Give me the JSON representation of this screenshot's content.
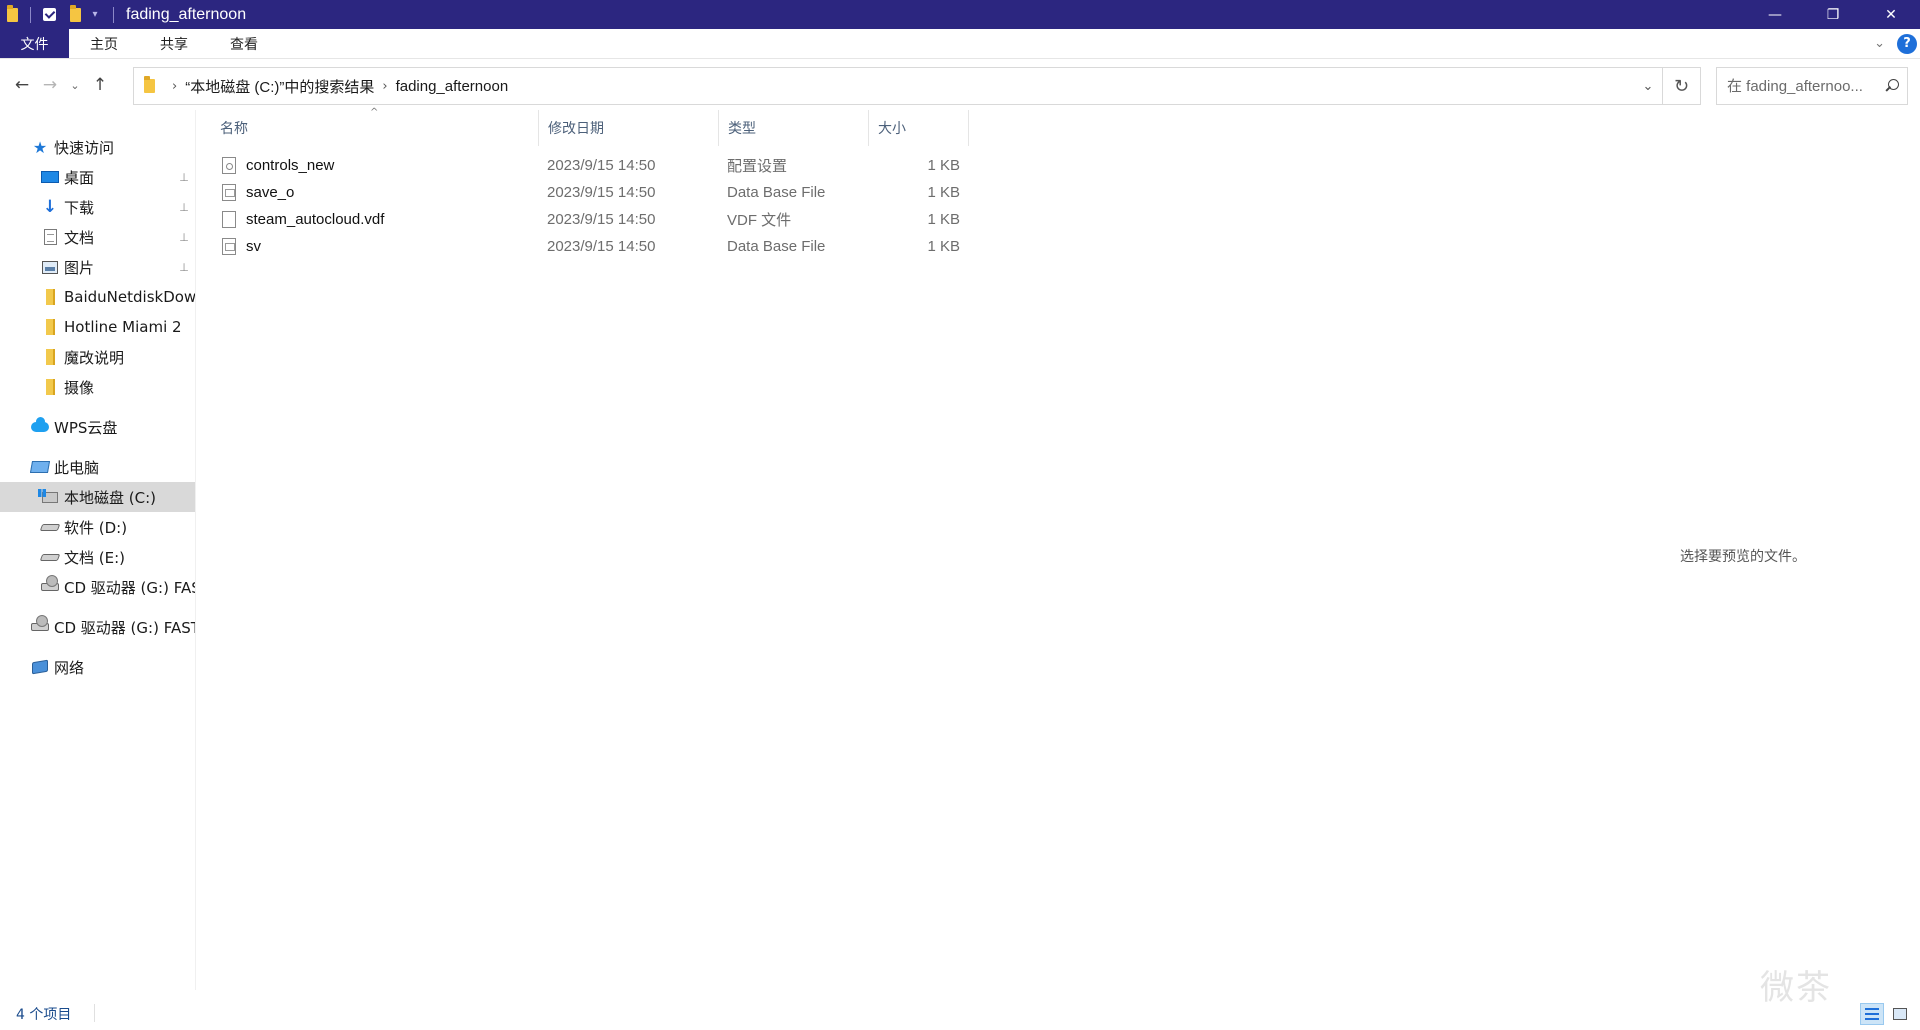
{
  "window": {
    "title": "fading_afternoon",
    "minimize": "—",
    "restore": "❐",
    "close": "✕"
  },
  "quick_access_toolbar": {
    "dropdown": "▾"
  },
  "ribbon": {
    "tabs": [
      "文件",
      "主页",
      "共享",
      "查看"
    ],
    "help": "?",
    "expand": "⌄"
  },
  "address": {
    "crumbs": [
      "“本地磁盘 (C:)”中的搜索结果",
      "fading_afternoon"
    ],
    "separator": "›",
    "search_placeholder": "在 fading_afternoo...",
    "refresh": "↻",
    "dropdown": "⌄"
  },
  "nav": {
    "back": "←",
    "forward": "→",
    "recent": "⌄",
    "up": "↑"
  },
  "sidebar": {
    "quick_access": "快速访问",
    "pinned": [
      {
        "label": "桌面",
        "icon": "desktop-icon"
      },
      {
        "label": "下载",
        "icon": "download-icon"
      },
      {
        "label": "文档",
        "icon": "documents-icon"
      },
      {
        "label": "图片",
        "icon": "pictures-icon"
      }
    ],
    "folders": [
      "BaiduNetdiskDow",
      "Hotline Miami 2",
      "魔改说明",
      "摄像"
    ],
    "wps": "WPS云盘",
    "this_pc": "此电脑",
    "drives": [
      {
        "label": "本地磁盘 (C:)",
        "selected": true
      },
      {
        "label": "软件 (D:)",
        "selected": false
      },
      {
        "label": "文档 (E:)",
        "selected": false
      },
      {
        "label": "CD 驱动器 (G:) FAS",
        "selected": false
      }
    ],
    "cd_root": "CD 驱动器 (G:) FAST",
    "network": "网络",
    "pin_glyph": "📌"
  },
  "columns": {
    "name": "名称",
    "date": "修改日期",
    "type": "类型",
    "size": "大小",
    "sort_indicator": "^"
  },
  "files": [
    {
      "name": "controls_new",
      "date": "2023/9/15 14:50",
      "type": "配置设置",
      "size": "1 KB",
      "icon": "config-file-icon"
    },
    {
      "name": "save_o",
      "date": "2023/9/15 14:50",
      "type": "Data Base File",
      "size": "1 KB",
      "icon": "database-file-icon"
    },
    {
      "name": "steam_autocloud.vdf",
      "date": "2023/9/15 14:50",
      "type": "VDF 文件",
      "size": "1 KB",
      "icon": "blank-file-icon"
    },
    {
      "name": "sv",
      "date": "2023/9/15 14:50",
      "type": "Data Base File",
      "size": "1 KB",
      "icon": "database-file-icon"
    }
  ],
  "preview": {
    "message": "选择要预览的文件。"
  },
  "status": {
    "item_count": "4 个项目"
  },
  "watermark": "微茶"
}
